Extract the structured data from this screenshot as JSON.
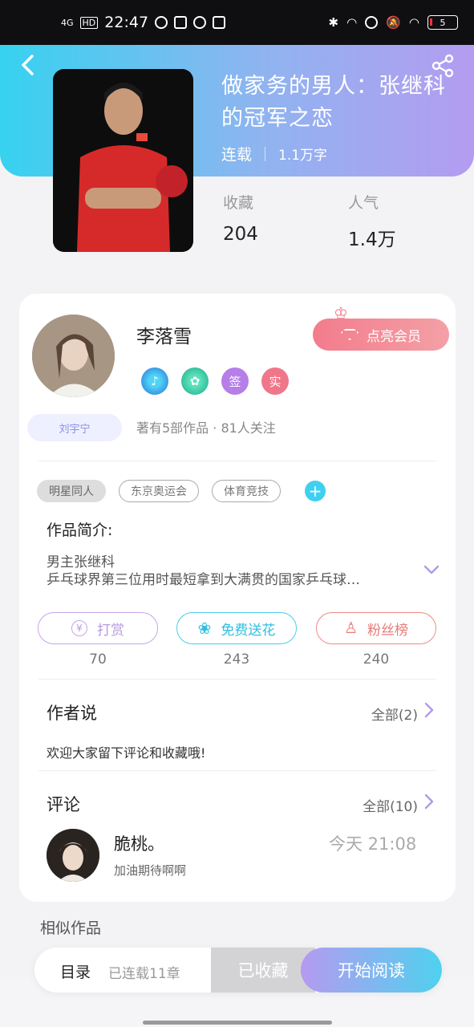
{
  "status_bar": {
    "network": "4G",
    "hd": "HD",
    "time": "22:47",
    "battery": "5"
  },
  "book": {
    "title": "做家务的男人：张继科的冠军之恋",
    "status": "连载",
    "word_count": "1.1万字",
    "favorites_label": "收藏",
    "favorites_value": "204",
    "popularity_label": "人气",
    "popularity_value": "1.4万"
  },
  "author": {
    "name": "李落雪",
    "badge_name": "刘宇宁",
    "vip_label": "点亮会员",
    "honors": [
      "签",
      "实"
    ],
    "works_info": "著有5部作品 · 81人关注"
  },
  "tags": [
    "明星同人",
    "东京奥运会",
    "体育竞技"
  ],
  "intro": {
    "heading": "作品简介:",
    "line1": "男主张继科",
    "line2": "乒乓球界第三位用时最短拿到大满贯的国家乒乓球…"
  },
  "actions": [
    {
      "label": "打赏",
      "count": "70",
      "color": "#c5a5ea"
    },
    {
      "label": "免费送花",
      "count": "243",
      "color": "#49cde8"
    },
    {
      "label": "粉丝榜",
      "count": "240",
      "color": "#ec8a86"
    }
  ],
  "author_says": {
    "heading": "作者说",
    "more": "全部(2)",
    "message": "欢迎大家留下评论和收藏哦!"
  },
  "comments": {
    "heading": "评论",
    "more": "全部(10)",
    "items": [
      {
        "name": "脆桃。",
        "time": "今天 21:08",
        "text": "加油期待啊啊"
      }
    ]
  },
  "similar_heading": "相似作品",
  "bottom_bar": {
    "toc": "目录",
    "chapters": "已连载11章",
    "collected": "已收藏",
    "read": "开始阅读"
  }
}
